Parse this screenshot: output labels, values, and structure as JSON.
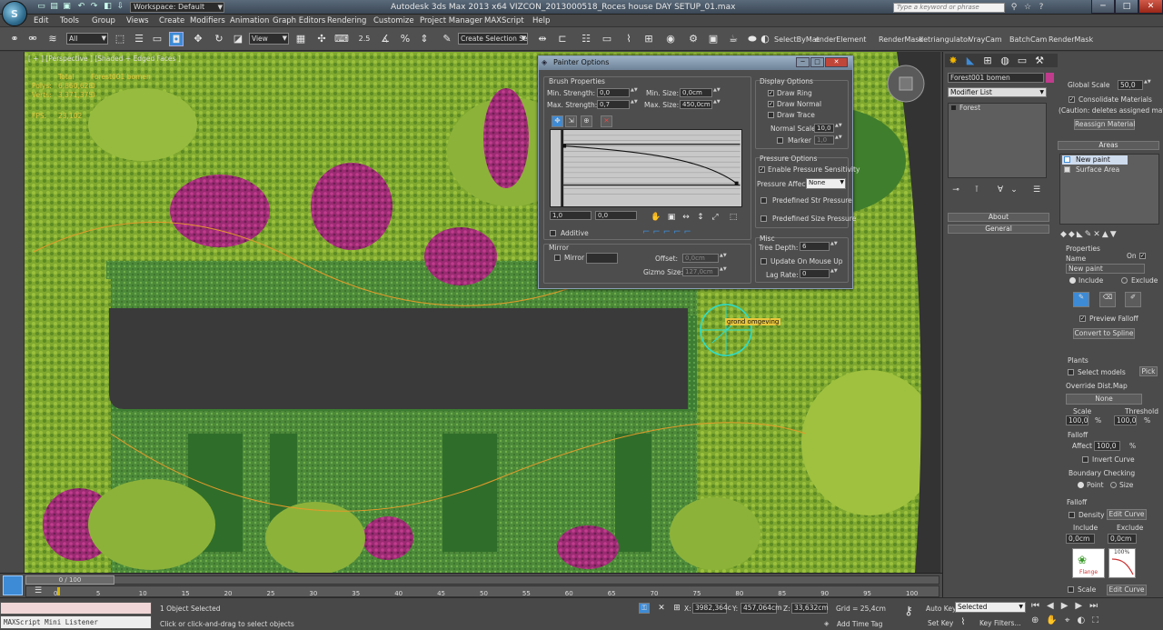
{
  "window": {
    "workspace_label": "Workspace: Default",
    "title": "Autodesk 3ds Max  2013 x64      VIZCON_2013000518_Roces house DAY SETUP_01.max",
    "search_placeholder": "Type a keyword or phrase",
    "logo": "S"
  },
  "menu": [
    "Edit",
    "Tools",
    "Group",
    "Views",
    "Create",
    "Modifiers",
    "Animation",
    "Graph Editors",
    "Rendering",
    "Customize",
    "Project Manager",
    "MAXScript",
    "Help"
  ],
  "toolbar": {
    "filter_select": "All",
    "view_select": "View",
    "snap_label": "2.5",
    "selection_set_placeholder": "Create Selection Se",
    "scripts": [
      "SelectByMat",
      "enderElement",
      "RenderMask",
      "detriangulator",
      "VrayCam",
      "BatchCam",
      "RenderMask"
    ]
  },
  "viewport": {
    "label": "[ + ] [Perspective ] [Shaded + Edged Faces ]",
    "stats_header_total": "Total",
    "stats_header_object": "Forest001 bomen",
    "stats_rows": [
      {
        "label": "Polys:",
        "total": "6,860,628",
        "object": "0"
      },
      {
        "label": "Verts:",
        "total": "3,371,375",
        "object": "0"
      }
    ],
    "fps_label": "FPS:",
    "fps_value": "23,102",
    "brush_tag": "grond omgeving"
  },
  "painter": {
    "title": "Painter Options",
    "brush_properties": "Brush Properties",
    "min_strength_label": "Min. Strength:",
    "min_strength": "0,0",
    "max_strength_label": "Max. Strength:",
    "max_strength": "0,7",
    "min_size_label": "Min. Size:",
    "min_size": "0,0cm",
    "max_size_label": "Max. Size:",
    "max_size": "450,0cm",
    "curve_y1": "1",
    "curve_y0": "0",
    "curve_field1": "1,0",
    "curve_field2": "0,0",
    "additive": "Additive",
    "mirror_group": "Mirror",
    "mirror": "Mirror",
    "offset_label": "Offset:",
    "offset": "0,0cm",
    "gizmo_label": "Gizmo Size:",
    "gizmo": "127,0cm",
    "display_options": "Display Options",
    "draw_ring": "Draw Ring",
    "draw_normal": "Draw Normal",
    "draw_trace": "Draw Trace",
    "normal_scale_label": "Normal Scale:",
    "normal_scale": "10,0",
    "marker_label": "Marker",
    "marker": "1,0",
    "pressure_options": "Pressure Options",
    "enable_pressure": "Enable Pressure Sensitivity",
    "pressure_affects_label": "Pressure Affects:",
    "pressure_affects": "None",
    "predefined_str": "Predefined Str Pressure",
    "predefined_size": "Predefined Size Pressure",
    "misc": "Misc",
    "tree_depth_label": "Tree Depth:",
    "tree_depth": "6",
    "update_on_mouse_up": "Update On Mouse Up",
    "lag_rate_label": "Lag Rate:",
    "lag_rate": "0"
  },
  "command_panel": {
    "object_name": "Forest001 bomen",
    "modifier_list": "Modifier List",
    "stack_item": "Forest",
    "rollout_about": "About",
    "rollout_general": "General",
    "global_scale_label": "Global Scale",
    "global_scale": "50,0",
    "consolidate": "Consolidate Materials",
    "caution": "(Caution: deletes assigned mat!)",
    "reassign": "Reassign Material",
    "areas_header": "Areas",
    "areas": [
      "New paint",
      "Surface Area"
    ],
    "properties": "Properties",
    "name_label": "Name",
    "on_label": "On",
    "name_value": "New paint",
    "include": "Include",
    "exclude": "Exclude",
    "preview_falloff": "Preview Falloff",
    "convert_spline": "Convert to Spline",
    "plants": "Plants",
    "select_models": "Select models",
    "pick": "Pick",
    "override_dist": "Override Dist.Map",
    "none": "None",
    "scale_label": "Scale",
    "threshold_label": "Threshold",
    "scale": "100,0",
    "threshold": "100,0",
    "pct": "%",
    "falloff": "Falloff",
    "affect_label": "Affect",
    "affect": "100,0",
    "invert_curve": "Invert Curve",
    "boundary": "Boundary Checking",
    "point": "Point",
    "size": "Size",
    "falloff2": "Falloff",
    "density": "Density",
    "edit_curve": "Edit Curve",
    "include2": "Include",
    "exclude2": "Exclude",
    "inc_val": "0,0cm",
    "exc_val": "0,0cm",
    "thumb_pct": "100%",
    "thumb_label": "Flange",
    "scale2": "Scale",
    "edit_curve2": "Edit Curve"
  },
  "timeline": {
    "frame": "0 / 100",
    "ticks": [
      "0",
      "5",
      "10",
      "15",
      "20",
      "25",
      "30",
      "35",
      "40",
      "45",
      "50",
      "55",
      "60",
      "65",
      "70",
      "75",
      "80",
      "85",
      "90",
      "95",
      "100"
    ]
  },
  "status": {
    "listener": "MAXScript Mini Listener",
    "selected": "1 Object Selected",
    "hint": "Click or click-and-drag to select objects",
    "x_label": "X:",
    "x": "3982,364c",
    "y_label": "Y:",
    "y": "457,064cm",
    "z_label": "Z:",
    "z": "33,632cm",
    "grid": "Grid = 25,4cm",
    "add_time_tag": "Add Time Tag",
    "auto_key": "Auto Key",
    "set_key": "Set Key",
    "selected_dd": "Selected",
    "key_filters": "Key Filters..."
  },
  "colors": {
    "accent": "#3d8bd6",
    "ring": "#29e0d0",
    "plaster": "#3a3a3a",
    "magenta": "#c13c8d"
  }
}
